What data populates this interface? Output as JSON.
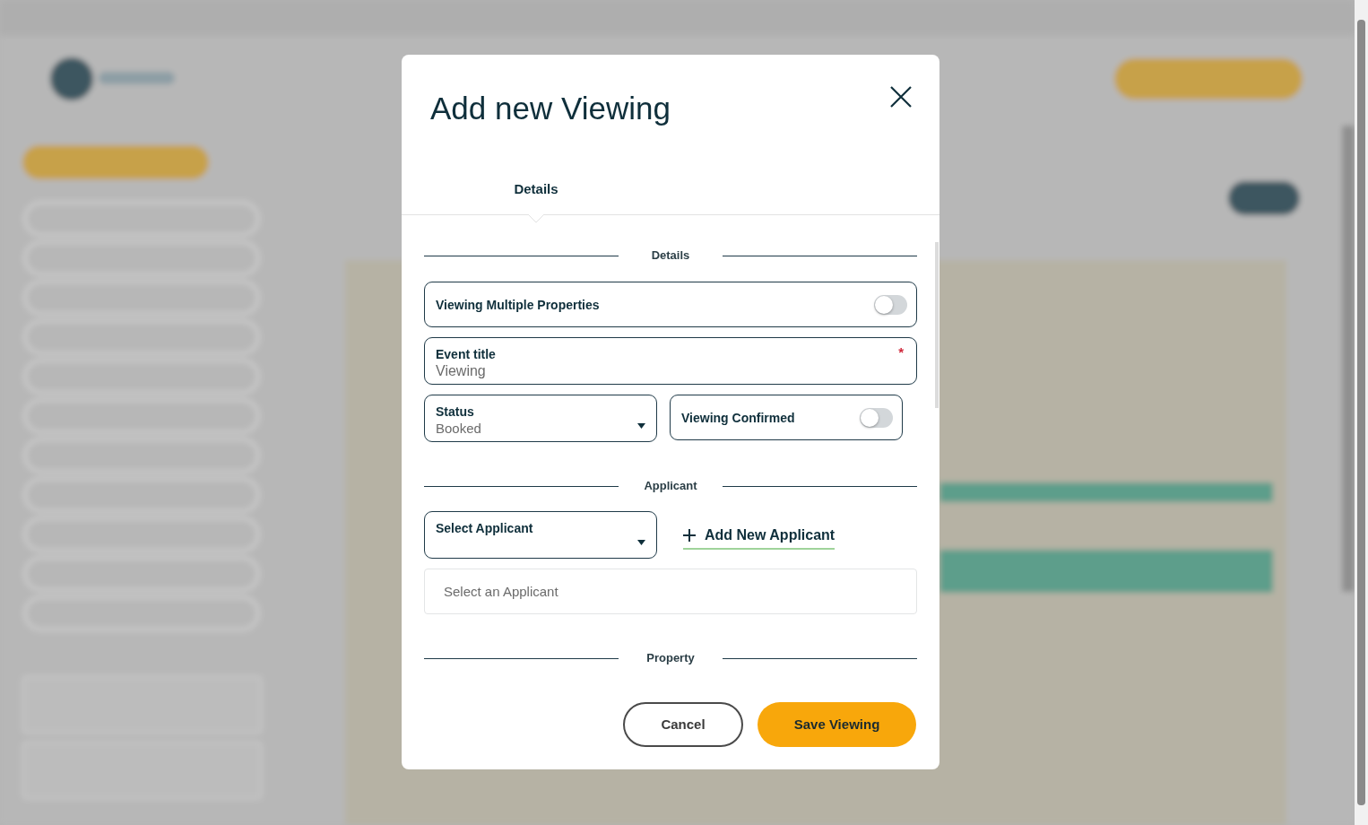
{
  "dialog": {
    "title": "Add new Viewing",
    "tabs": [
      {
        "label": "Details",
        "selected": true
      }
    ],
    "sections": [
      {
        "heading": "Details",
        "rows": [
          [
            {
              "kind": "toggle",
              "label": "Viewing Multiple Properties",
              "on": false
            }
          ],
          [
            {
              "kind": "text",
              "label": "Event title",
              "value": "Viewing",
              "required_mark": "*"
            }
          ],
          [
            {
              "kind": "select",
              "label": "Status",
              "value": "Booked"
            },
            {
              "kind": "toggle",
              "label": "Viewing Confirmed",
              "on": false
            }
          ]
        ]
      },
      {
        "heading": "Applicant",
        "rows": [
          [
            {
              "kind": "select",
              "label": "Select Applicant"
            },
            {
              "kind": "link",
              "label": "Add New Applicant"
            }
          ],
          [
            {
              "kind": "search",
              "placeholder": "Select an Applicant"
            }
          ]
        ]
      },
      {
        "heading": "Property"
      }
    ],
    "buttons": [
      {
        "kind": "secondary",
        "label": "Cancel"
      },
      {
        "kind": "primary",
        "label": "Save Viewing"
      }
    ]
  }
}
